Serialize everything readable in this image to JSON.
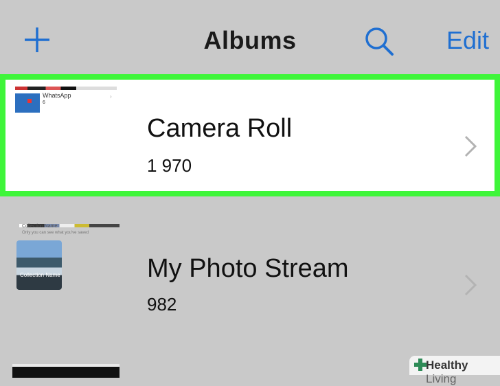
{
  "navbar": {
    "title": "Albums",
    "edit_label": "Edit",
    "accent": "#1f6fd1"
  },
  "highlight_color": "#3ff53a",
  "albums": [
    {
      "name": "Camera Roll",
      "count": "1 970",
      "thumb": {
        "label": "WhatsApp",
        "sub": "6"
      }
    },
    {
      "name": "My Photo Stream",
      "count": "982",
      "thumb": {
        "title": "Collection Name",
        "subtitle": "Only you can see what you've saved",
        "card_label": "Collection Name"
      }
    }
  ],
  "watermark": {
    "bold": "Healthy",
    "light": " Living"
  }
}
